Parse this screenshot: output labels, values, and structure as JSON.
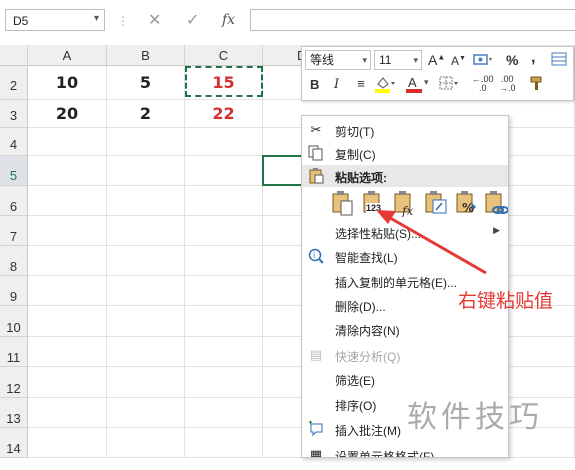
{
  "formula_bar": {
    "name_box": "D5",
    "cancel_icon": "✕",
    "confirm_icon": "✓",
    "fx_icon": "fx"
  },
  "columns": [
    "A",
    "B",
    "C",
    "D"
  ],
  "rows": [
    "2",
    "3",
    "4",
    "5",
    "6",
    "7",
    "8",
    "9",
    "10",
    "11",
    "12",
    "13",
    "14"
  ],
  "cells": {
    "A2": "10",
    "B2": "5",
    "C2": "15",
    "A3": "20",
    "B3": "2",
    "C3": "22"
  },
  "colors": {
    "formula_result": "#d32f2f",
    "arrow": "#e53935",
    "selection": "#217346",
    "copy_marquee": "#217346",
    "watermark": "#ababab"
  },
  "mini_toolbar": {
    "font_name": "等线",
    "font_size": "11",
    "grow_font": "A",
    "shrink_font": "A",
    "percent": "%",
    "comma": ",",
    "bold": "B",
    "italic": "I",
    "font_color_letter": "A",
    "inc_decimal": ".00",
    "dec_decimal": ".00"
  },
  "context_menu": {
    "items": [
      {
        "label": "剪切(T)",
        "icon": "cut-icon",
        "enabled": true
      },
      {
        "label": "复制(C)",
        "icon": "copy-icon",
        "enabled": true
      },
      {
        "label": "粘贴选项:",
        "icon": "paste-icon",
        "enabled": true,
        "header": true
      },
      {
        "label": "选择性粘贴(S)...",
        "icon": "",
        "enabled": true,
        "submenu": true
      },
      {
        "label": "智能查找(L)",
        "icon": "smart-lookup-icon",
        "enabled": true
      },
      {
        "label": "插入复制的单元格(E)...",
        "icon": "",
        "enabled": true
      },
      {
        "label": "删除(D)...",
        "icon": "",
        "enabled": true
      },
      {
        "label": "清除内容(N)",
        "icon": "",
        "enabled": true
      },
      {
        "label": "快速分析(Q)",
        "icon": "quick-analysis-icon",
        "enabled": false
      },
      {
        "label": "筛选(E)",
        "icon": "",
        "enabled": true,
        "submenu": true
      },
      {
        "label": "排序(O)",
        "icon": "",
        "enabled": true,
        "submenu": true
      },
      {
        "label": "插入批注(M)",
        "icon": "insert-comment-icon",
        "enabled": true
      },
      {
        "label": "设置单元格格式(F)...",
        "icon": "format-cells-icon",
        "enabled": true
      }
    ],
    "paste_options": [
      "paste",
      "values",
      "formulas",
      "transpose",
      "formatting",
      "paste-link"
    ],
    "paste_values_label": "123"
  },
  "annotation": "右键粘贴值",
  "watermark": "软件技巧"
}
